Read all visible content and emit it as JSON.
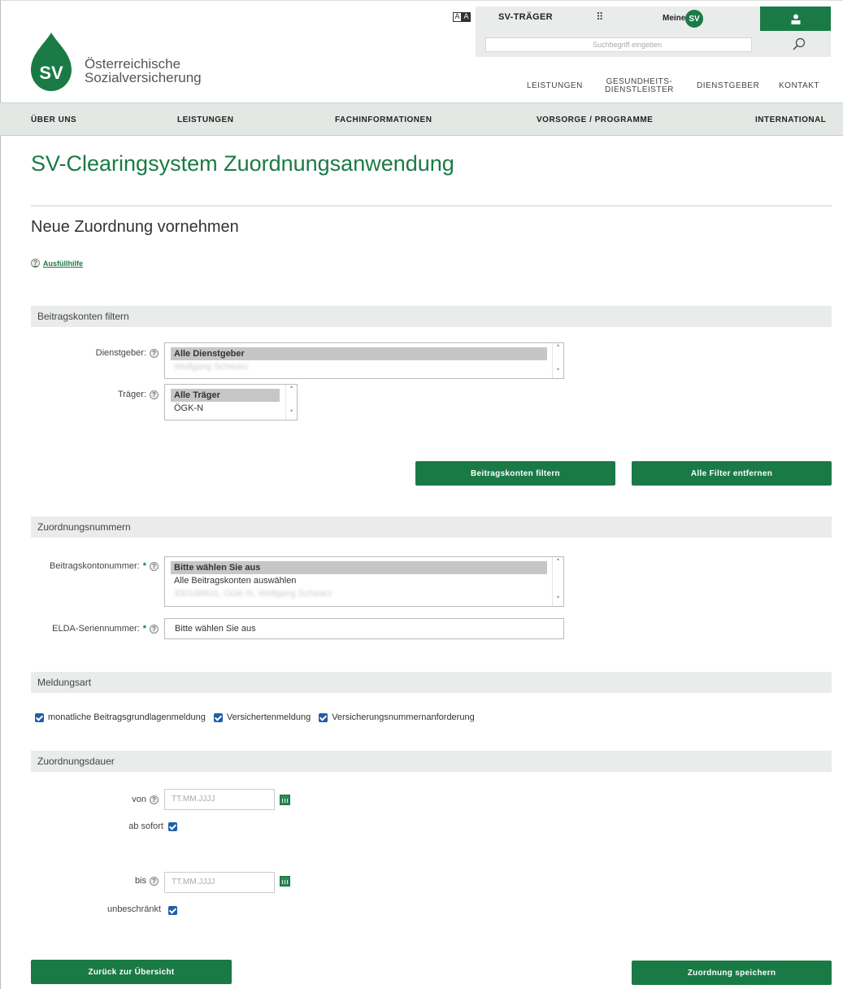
{
  "header": {
    "logo_line1": "Österreichische",
    "logo_line2": "Sozialversicherung",
    "logo_mark": "SV",
    "sv_traeger": "SV-TRÄGER",
    "meine": "Meine",
    "meine_badge": "SV",
    "search_placeholder": "Suchbegriff eingeben",
    "top_nav": [
      {
        "label": "LEISTUNGEN"
      },
      {
        "label": "GESUNDHEITS-",
        "label2": "DIENSTLEISTER"
      },
      {
        "label": "DIENSTGEBER"
      },
      {
        "label": "KONTAKT"
      }
    ]
  },
  "nav": [
    "ÜBER UNS",
    "LEISTUNGEN",
    "FACHINFORMATIONEN",
    "VORSORGE / PROGRAMME",
    "INTERNATIONAL"
  ],
  "page": {
    "title": "SV-Clearingsystem Zuordnungsanwendung",
    "subtitle": "Neue Zuordnung vornehmen",
    "help_link": "Ausfüllhilfe"
  },
  "filter": {
    "section": "Beitragskonten filtern",
    "dienstgeber_label": "Dienstgeber:",
    "dienstgeber_options": [
      "Alle Dienstgeber",
      "Wolfgang Schwarz"
    ],
    "traeger_label": "Träger:",
    "traeger_options": [
      "Alle Träger",
      "ÖGK-N"
    ],
    "filter_button": "Beitragskonten filtern",
    "reset_button": "Alle Filter entfernen"
  },
  "numbers": {
    "section": "Zuordnungsnummern",
    "konto_label": "Beitragskontonummer:",
    "konto_options": [
      "Bitte wählen Sie aus",
      "Alle Beitragskonten auswählen",
      "330188631, ÖGK-N, Wolfgang Schwarz"
    ],
    "elda_label": "ELDA-Seriennummer:",
    "elda_value": "Bitte wählen Sie aus",
    "required_mark": "*"
  },
  "meldungsart": {
    "section": "Meldungsart",
    "options": [
      "monatliche Beitragsgrundlagenmeldung",
      "Versichertenmeldung",
      "Versicherungsnummernanforderung"
    ]
  },
  "dauer": {
    "section": "Zuordnungsdauer",
    "von_label": "von",
    "date_placeholder": "TT.MM.JJJJ",
    "ab_sofort": "ab sofort",
    "bis_label": "bis",
    "unbeschraenkt": "unbeschränkt"
  },
  "footer": {
    "back_button": "Zurück zur Übersicht",
    "save_button": "Zuordnung speichern"
  },
  "colors": {
    "brand": "#1a7a45",
    "checkbox": "#1d5fa8",
    "section_bg": "#e9eceb"
  }
}
